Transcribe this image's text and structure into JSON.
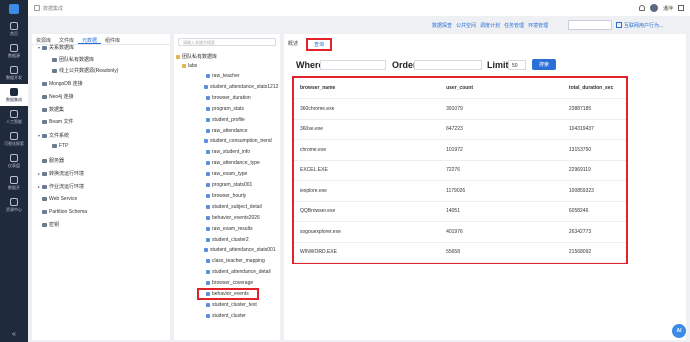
{
  "header": {
    "breadcrumb": "数据集成",
    "username": "潘萍"
  },
  "nav": {
    "items": [
      {
        "label": "首页",
        "icon": "home-icon"
      },
      {
        "label": "数据源",
        "icon": "database-icon"
      },
      {
        "label": "数据开发",
        "icon": "code-icon"
      },
      {
        "label": "数据集成",
        "icon": "integration-icon"
      },
      {
        "label": "人工智能",
        "icon": "ai-icon"
      },
      {
        "label": "可视化探索",
        "icon": "chart-icon"
      },
      {
        "label": "仪表盘",
        "icon": "dashboard-icon"
      },
      {
        "label": "数据开",
        "icon": "open-icon"
      },
      {
        "label": "资源中心",
        "icon": "resource-icon"
      }
    ],
    "active_index": 3
  },
  "toolbar": {
    "links": [
      "数据探查",
      "公共空间",
      "调度计划",
      "任务管理",
      "环境管理"
    ],
    "action_link": "互联网用户行为..."
  },
  "resource_panel": {
    "tabs": [
      "资源库",
      "文件库",
      "元数据",
      "组件库"
    ],
    "active_tab": 2,
    "items": [
      {
        "label": "关系数据库",
        "indent": 0,
        "toggle": "▾",
        "icon": "db"
      },
      {
        "label": "团队私有数据库",
        "indent": 1,
        "toggle": "",
        "icon": "db"
      },
      {
        "label": "线上公共数据源(Readonly)",
        "indent": 1,
        "toggle": "",
        "icon": "db"
      },
      {
        "label": "MongoDB 连接",
        "indent": 0,
        "toggle": "",
        "icon": "db"
      },
      {
        "label": "Neo4j 连接",
        "indent": 0,
        "toggle": "",
        "icon": "db"
      },
      {
        "label": "数据集",
        "indent": 0,
        "toggle": "",
        "icon": "db"
      },
      {
        "label": "Beam 文件",
        "indent": 0,
        "toggle": "",
        "icon": "db"
      },
      {
        "label": "文件系统",
        "indent": 0,
        "toggle": "▾",
        "icon": "db"
      },
      {
        "label": "FTP",
        "indent": 1,
        "toggle": "",
        "icon": "db"
      },
      {
        "label": "服务器",
        "indent": 0,
        "toggle": "",
        "icon": "db"
      },
      {
        "label": "转换流运行环境",
        "indent": 0,
        "toggle": "▸",
        "icon": "db"
      },
      {
        "label": "作业流运行环境",
        "indent": 0,
        "toggle": "▸",
        "icon": "db"
      },
      {
        "label": "Web Service",
        "indent": 0,
        "toggle": "",
        "icon": "db"
      },
      {
        "label": "Partition Schema",
        "indent": 0,
        "toggle": "",
        "icon": "db"
      },
      {
        "label": "密钥",
        "indent": 0,
        "toggle": "",
        "icon": "db"
      }
    ]
  },
  "table_panel": {
    "search_placeholder": "请输入关键字搜索",
    "root": "团队私有数据库",
    "schema": "labs",
    "tables": [
      "raw_teacher",
      "student_attendance_stats1212",
      "browser_duration",
      "program_stats",
      "student_profile",
      "raw_attendance",
      "student_consumption_trend",
      "raw_student_info",
      "raw_attendance_type",
      "raw_exam_type",
      "program_stats001",
      "browser_hourly",
      "student_subject_detail",
      "behavior_events2026",
      "raw_exam_results",
      "student_cluster2",
      "student_attendance_stats001",
      "class_teacher_mapping",
      "student_attendance_detail",
      "browser_coverage",
      "behavior_events",
      "student_cluster_test",
      "student_cluster"
    ],
    "selected": "browser_coverage"
  },
  "main": {
    "tabs": [
      "概述",
      "查询"
    ],
    "active_tab": 1,
    "where_label": "Where",
    "order_label": "Order",
    "limit_label": "Limit",
    "limit_value": "50",
    "query_button": "搜索"
  },
  "result": {
    "columns": [
      "browser_name",
      "user_count",
      "total_duration_sec"
    ],
    "rows": [
      [
        "360chrome.exe",
        "391079",
        "23887185"
      ],
      [
        "360se.exe",
        "647223",
        "104319437"
      ],
      [
        "chrome.exe",
        "101972",
        "13153750"
      ],
      [
        "EXCEL.EXE",
        "72276",
        "22969119"
      ],
      [
        "iexplore.exe",
        "1179026",
        "100859323"
      ],
      [
        "QQBrowser.exe",
        "14051",
        "6058246"
      ],
      [
        "sogouexplorer.exe",
        "401976",
        "26342773"
      ],
      [
        "WINWORD.EXE",
        "55658",
        "21568092"
      ]
    ]
  },
  "assistant_label": "AI",
  "colors": {
    "accent": "#2a6fd6",
    "highlight": "#e0242a",
    "nav_bg": "#1f2a3c"
  }
}
